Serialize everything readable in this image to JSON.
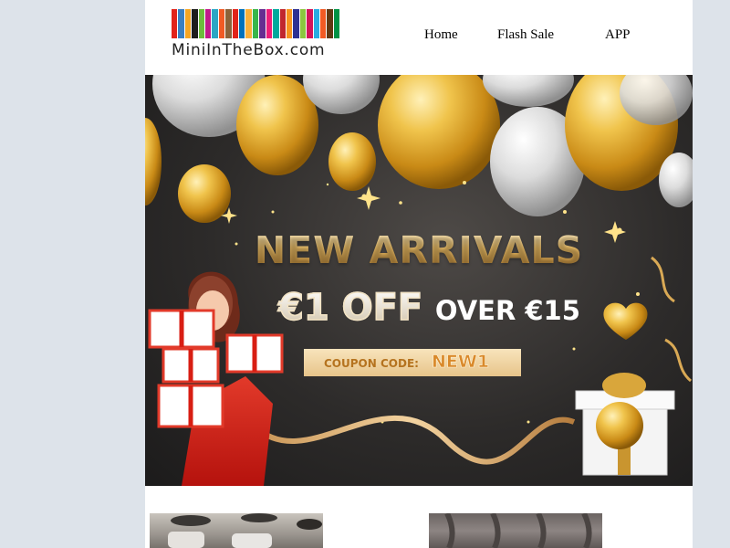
{
  "header": {
    "logo": {
      "text": "MiniInTheBox.com",
      "stripe_colors": [
        "#e2231a",
        "#3a7fc1",
        "#f5a623",
        "#1d1d1d",
        "#6cbb3c",
        "#c2188b",
        "#2aa6c4",
        "#f15a24",
        "#8c6239",
        "#e2231a",
        "#0071bc",
        "#fbb03b",
        "#39b54a",
        "#662d91",
        "#ed1e79",
        "#00a99d",
        "#c1272d",
        "#f7931e",
        "#2e3192",
        "#8cc63f",
        "#d4145a",
        "#29abe2",
        "#f15a24",
        "#603813",
        "#009245"
      ]
    },
    "nav": {
      "home": "Home",
      "flash_sale": "Flash Sale",
      "app": "APP"
    }
  },
  "hero": {
    "headline": "NEW ARRIVALS",
    "offer_amount": "€1 OFF",
    "offer_condition": "OVER €15",
    "coupon_label": "COUPON CODE:",
    "coupon_code": "NEW1",
    "colors": {
      "gold": "#e3b04b",
      "silver": "#dcdcdc",
      "dark_bg": "#2d2b2a",
      "red_dress": "#d9261c"
    }
  }
}
